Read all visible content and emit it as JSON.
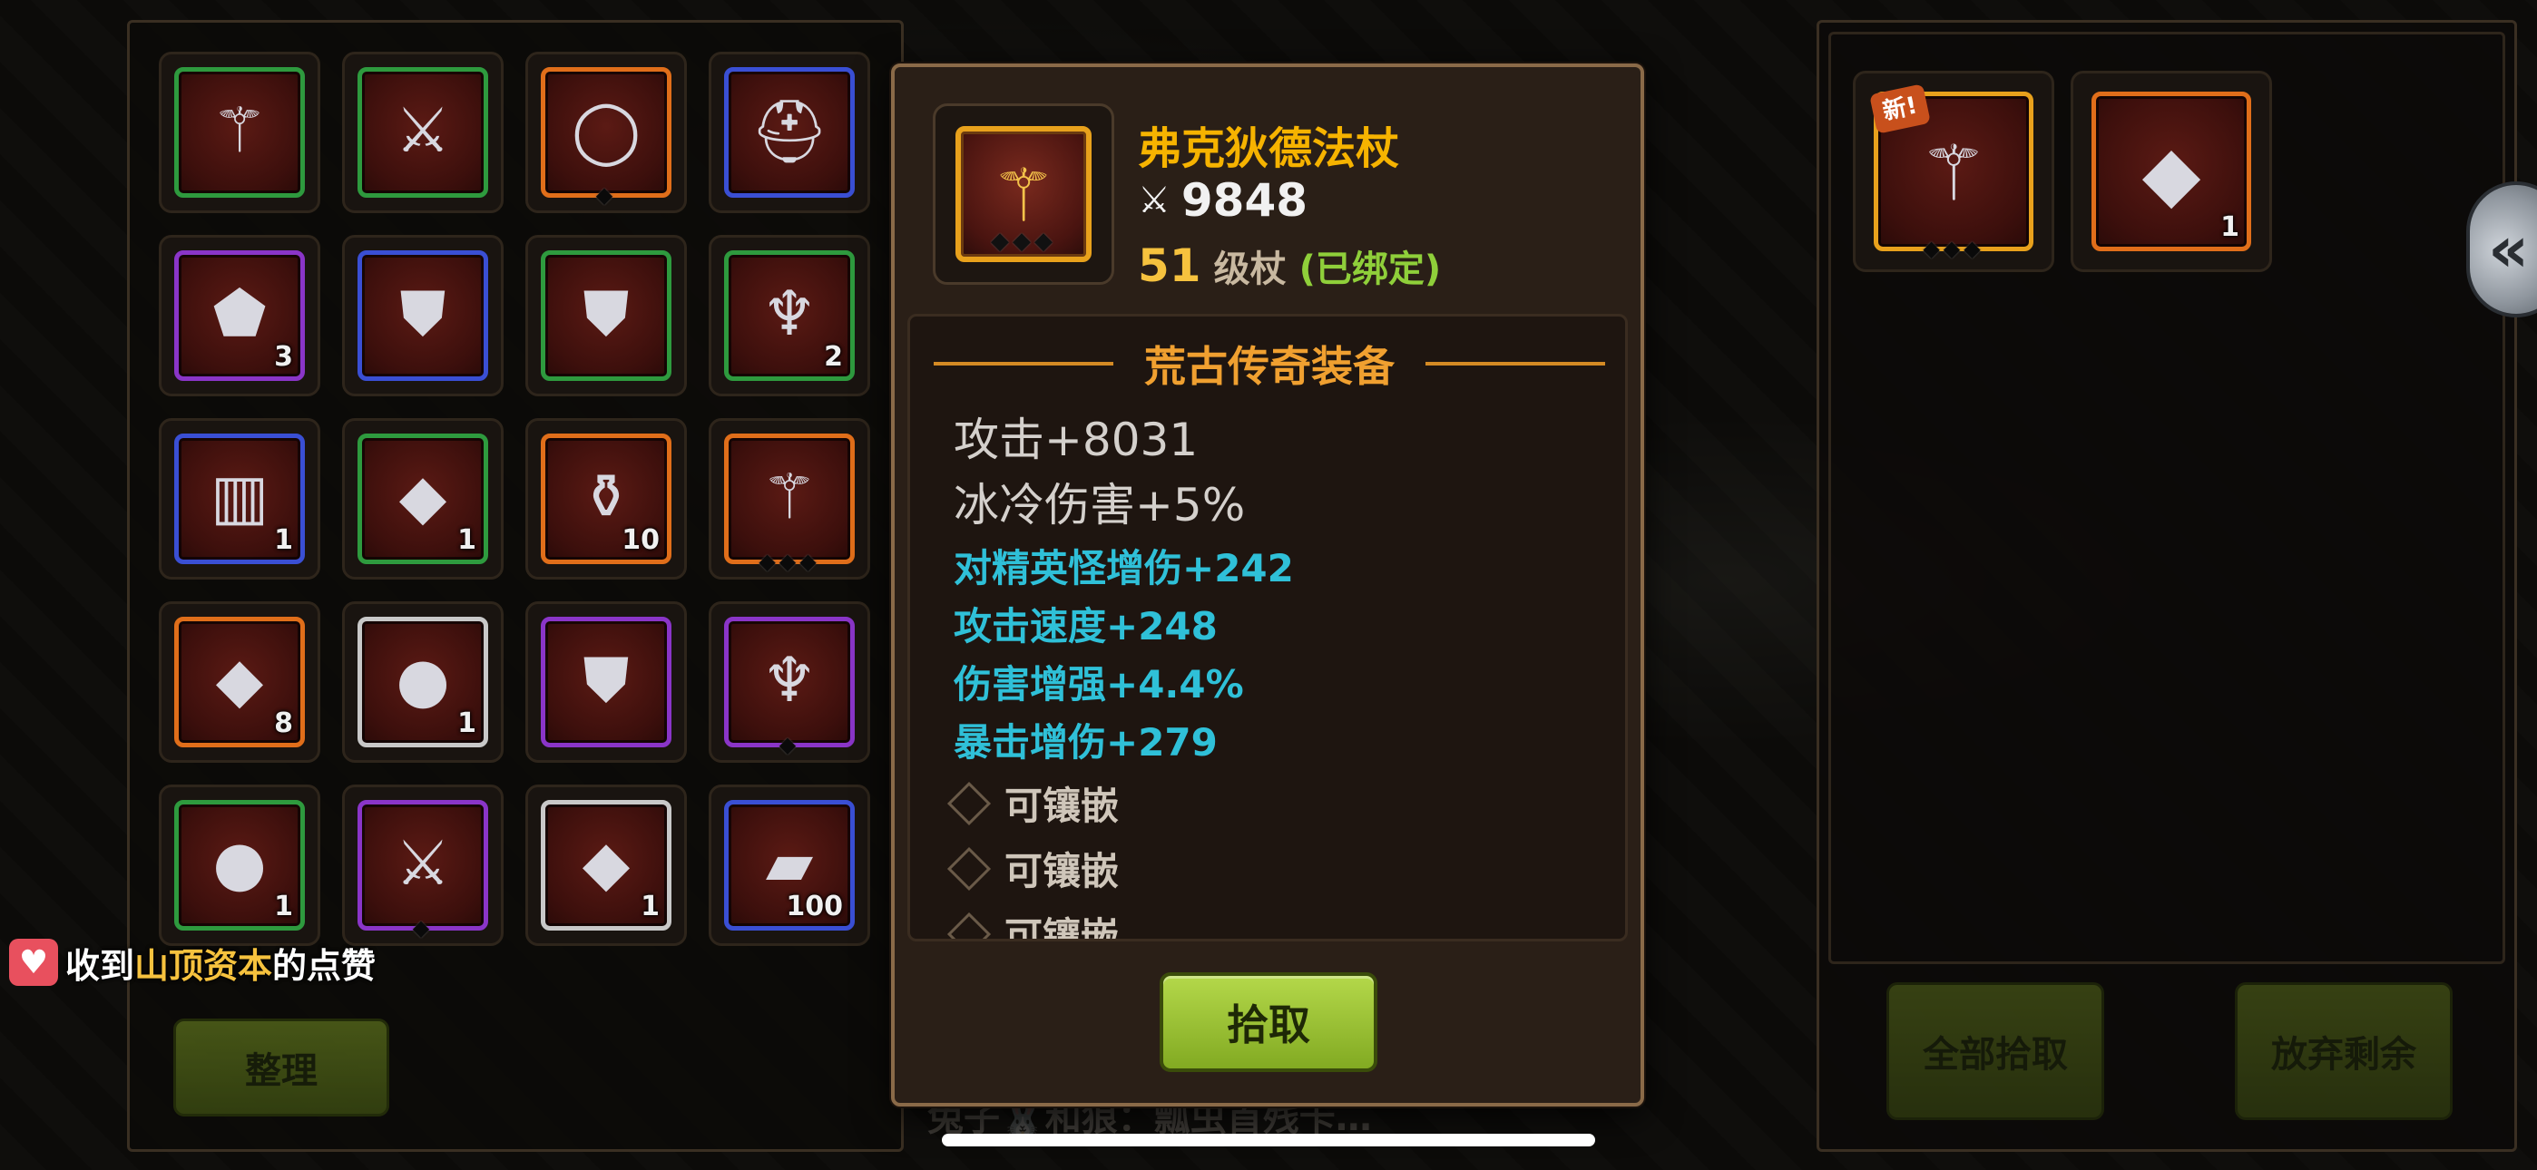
{
  "inventory": {
    "sort_label": "整理",
    "rows": [
      [
        {
          "icon": "mace-icon",
          "glyph": "⚚",
          "quality": "green",
          "count": "",
          "pips": ""
        },
        {
          "icon": "sword-icon",
          "glyph": "⚔",
          "quality": "green",
          "count": "",
          "pips": ""
        },
        {
          "icon": "ring-icon",
          "glyph": "◯",
          "quality": "orange",
          "count": "",
          "pips": "◆"
        },
        {
          "icon": "helmet-icon",
          "glyph": "⛑",
          "quality": "blue",
          "count": "",
          "pips": ""
        }
      ],
      [
        {
          "icon": "rune-stone-icon",
          "glyph": "⬟",
          "quality": "purple",
          "count": "3",
          "pips": ""
        },
        {
          "icon": "chest-armor-icon",
          "glyph": "⛊",
          "quality": "blue",
          "count": "",
          "pips": ""
        },
        {
          "icon": "chest-armor-icon",
          "glyph": "⛊",
          "quality": "green",
          "count": "",
          "pips": ""
        },
        {
          "icon": "demon-crest-icon",
          "glyph": "♆",
          "quality": "green",
          "count": "2",
          "pips": ""
        }
      ],
      [
        {
          "icon": "scroll-icon",
          "glyph": "▥",
          "quality": "blue",
          "count": "1",
          "pips": ""
        },
        {
          "icon": "crystal-icon",
          "glyph": "◆",
          "quality": "green",
          "count": "1",
          "pips": ""
        },
        {
          "icon": "potion-icon",
          "glyph": "⚱",
          "quality": "orange",
          "count": "10",
          "pips": ""
        },
        {
          "icon": "staff-icon",
          "glyph": "⚚",
          "quality": "orange",
          "count": "",
          "pips": "◆◆◆"
        }
      ],
      [
        {
          "icon": "purple-crystal-icon",
          "glyph": "◆",
          "quality": "orange",
          "count": "8",
          "pips": ""
        },
        {
          "icon": "orb-icon",
          "glyph": "●",
          "quality": "white",
          "count": "1",
          "pips": ""
        },
        {
          "icon": "vest-icon",
          "glyph": "⛊",
          "quality": "purple",
          "count": "",
          "pips": ""
        },
        {
          "icon": "trident-icon",
          "glyph": "♆",
          "quality": "purple",
          "count": "",
          "pips": "◆"
        }
      ],
      [
        {
          "icon": "red-gem-icon",
          "glyph": "●",
          "quality": "green",
          "count": "1",
          "pips": ""
        },
        {
          "icon": "saber-icon",
          "glyph": "⚔",
          "quality": "purple",
          "count": "",
          "pips": "◆"
        },
        {
          "icon": "blue-gem-icon",
          "glyph": "◆",
          "quality": "white",
          "count": "1",
          "pips": ""
        },
        {
          "icon": "iron-ingot-icon",
          "glyph": "▰",
          "quality": "blue",
          "count": "100",
          "pips": ""
        }
      ]
    ]
  },
  "toast": {
    "prefix": "收到",
    "name": "山顶资本",
    "suffix": "的点赞"
  },
  "item": {
    "name": "弗克狄德法杖",
    "icon": "staff-icon",
    "glyph": "⚚",
    "pips": "◆◆◆",
    "power": "9848",
    "level": "51",
    "level_type": "级杖",
    "bound": "(已绑定)",
    "rarity": "荒古传奇装备",
    "base_stats": [
      "攻击+8031",
      "冰冷伤害+5%"
    ],
    "extra_stats": [
      "对精英怪增伤+242",
      "攻击速度+248",
      "伤害增强+4.4%",
      "暴击增伤+279"
    ],
    "sockets": [
      "可镶嵌",
      "可镶嵌",
      "可镶嵌"
    ],
    "pickup_label": "拾取"
  },
  "loot": {
    "items": [
      {
        "icon": "staff-icon",
        "glyph": "⚚",
        "quality": "gold",
        "badge": "新!",
        "count": "",
        "pips": "◆◆◆"
      },
      {
        "icon": "purple-crystal-icon",
        "glyph": "◆",
        "quality": "orange",
        "badge": "",
        "count": "1",
        "pips": ""
      }
    ],
    "pick_all_label": "全部拾取",
    "discard_label": "放弃剩余"
  },
  "chat": {
    "text": "兔子🐰和狼：瓢虫首残卡…"
  },
  "colors": {
    "rarity": "#f0a030",
    "extra_stat": "#2fc0d8",
    "item_name": "#f6b300",
    "bound": "#8fcf3a"
  }
}
